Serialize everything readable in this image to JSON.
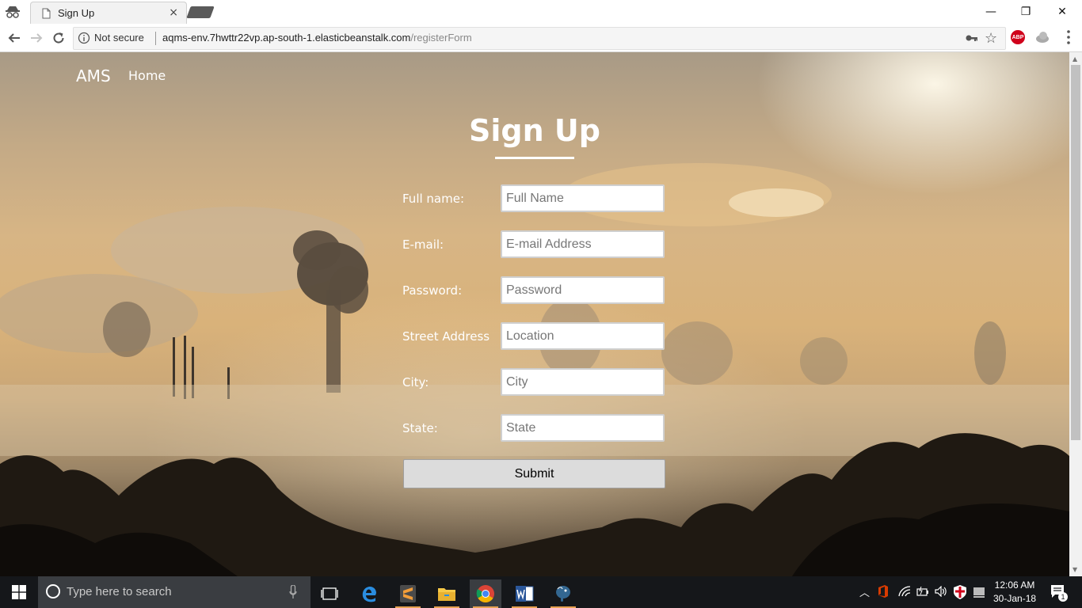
{
  "browser": {
    "tab_title": "Sign Up",
    "tab_close": "×",
    "security_label": "Not secure",
    "url_host": "aqms-env.7hwttr22vp.ap-south-1.elasticbeanstalk.com",
    "url_path": "/registerForm",
    "abp_label": "ABP",
    "window_controls": {
      "minimize": "—",
      "restore": "❐",
      "close": "✕"
    }
  },
  "navbar": {
    "brand": "AMS",
    "home": "Home"
  },
  "form": {
    "title": "Sign Up",
    "fields": [
      {
        "label": "Full name:",
        "placeholder": "Full Name"
      },
      {
        "label": "E-mail:",
        "placeholder": "E-mail Address"
      },
      {
        "label": "Password:",
        "placeholder": "Password"
      },
      {
        "label": "Street Address",
        "placeholder": "Location"
      },
      {
        "label": "City:",
        "placeholder": "City"
      },
      {
        "label": "State:",
        "placeholder": "State"
      }
    ],
    "submit_label": "Submit"
  },
  "taskbar": {
    "search_placeholder": "Type here to search",
    "clock_time": "12:06 AM",
    "clock_date": "30-Jan-18",
    "notification_count": "1",
    "pinned_apps": [
      "task-view-icon",
      "edge-icon",
      "sublime-text-icon",
      "file-explorer-icon",
      "chrome-icon",
      "word-icon",
      "postgresql-icon"
    ]
  },
  "colors": {
    "accent_underline": "#e8a252",
    "taskbar_bg": "#15171a",
    "abp_red": "#d0021b"
  }
}
